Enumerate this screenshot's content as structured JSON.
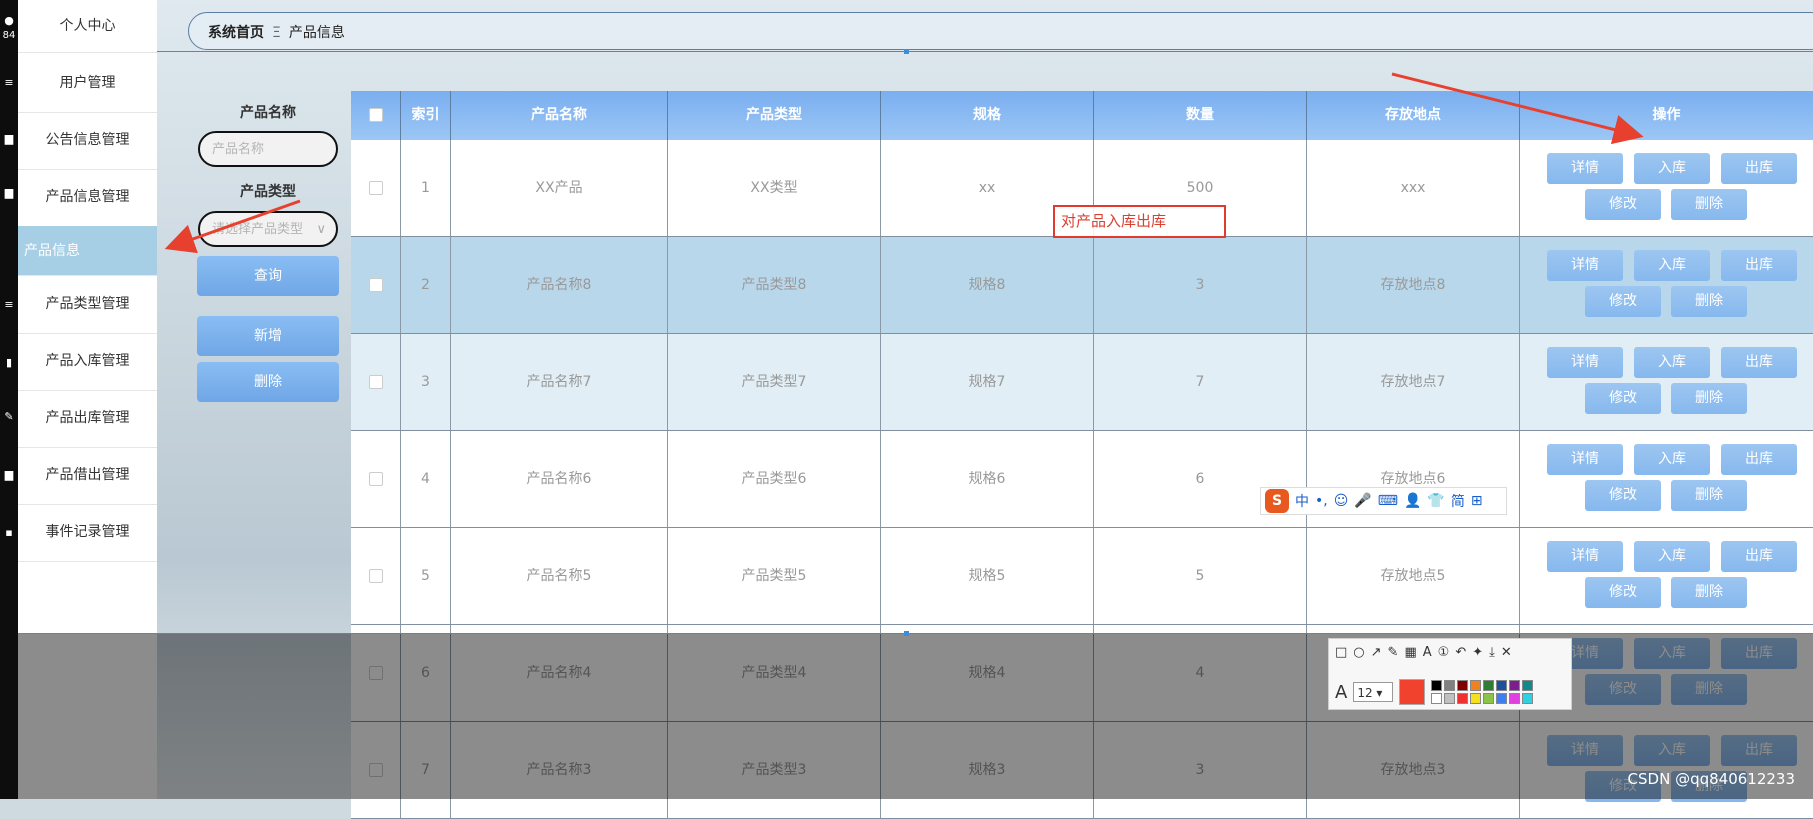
{
  "sidebar": {
    "user_label": "个人中心",
    "user_badge": "84",
    "items": [
      {
        "label": "用户管理"
      },
      {
        "label": "公告信息管理"
      },
      {
        "label": "产品信息管理"
      },
      {
        "label": "产品信息"
      },
      {
        "label": "产品类型管理"
      },
      {
        "label": "产品入库管理"
      },
      {
        "label": "产品出库管理"
      },
      {
        "label": "产品借出管理"
      },
      {
        "label": "事件记录管理"
      }
    ],
    "active_index": 3
  },
  "breadcrumb": {
    "home": "系统首页",
    "separator": "Ξ",
    "current": "产品信息"
  },
  "search": {
    "name_label": "产品名称",
    "name_placeholder": "产品名称",
    "type_label": "产品类型",
    "type_placeholder": "请选择产品类型",
    "query_button": "查询",
    "add_button": "新增",
    "delete_button": "删除"
  },
  "table": {
    "headers": [
      "索引",
      "产品名称",
      "产品类型",
      "规格",
      "数量",
      "存放地点",
      "操作"
    ],
    "actions": {
      "detail": "详情",
      "in": "入库",
      "out": "出库",
      "edit": "修改",
      "delete": "删除"
    },
    "rows": [
      {
        "index": "1",
        "name": "XX产品",
        "type": "XX类型",
        "spec": "xx",
        "qty": "500",
        "location": "xxx"
      },
      {
        "index": "2",
        "name": "产品名称8",
        "type": "产品类型8",
        "spec": "规格8",
        "qty": "3",
        "location": "存放地点8"
      },
      {
        "index": "3",
        "name": "产品名称7",
        "type": "产品类型7",
        "spec": "规格7",
        "qty": "7",
        "location": "存放地点7"
      },
      {
        "index": "4",
        "name": "产品名称6",
        "type": "产品类型6",
        "spec": "规格6",
        "qty": "6",
        "location": "存放地点6"
      },
      {
        "index": "5",
        "name": "产品名称5",
        "type": "产品类型5",
        "spec": "规格5",
        "qty": "5",
        "location": "存放地点5"
      },
      {
        "index": "6",
        "name": "产品名称4",
        "type": "产品类型4",
        "spec": "规格4",
        "qty": "4",
        "location": ""
      },
      {
        "index": "7",
        "name": "产品名称3",
        "type": "产品类型3",
        "spec": "规格3",
        "qty": "3",
        "location": "存放地点3"
      }
    ]
  },
  "annotation_text": "对产品入库出库",
  "ime": {
    "items": [
      "中",
      "•,",
      "☺",
      "🎤",
      "⌨",
      "👤",
      "👕",
      "简",
      "⊞"
    ]
  },
  "snip_toolbar": {
    "font_size": "12"
  },
  "watermark": "CSDN @qq840612233",
  "colors": {
    "accent": "#7aaef0",
    "active_sidebar": "#a6cfe6",
    "annotation": "#e23b2e"
  }
}
